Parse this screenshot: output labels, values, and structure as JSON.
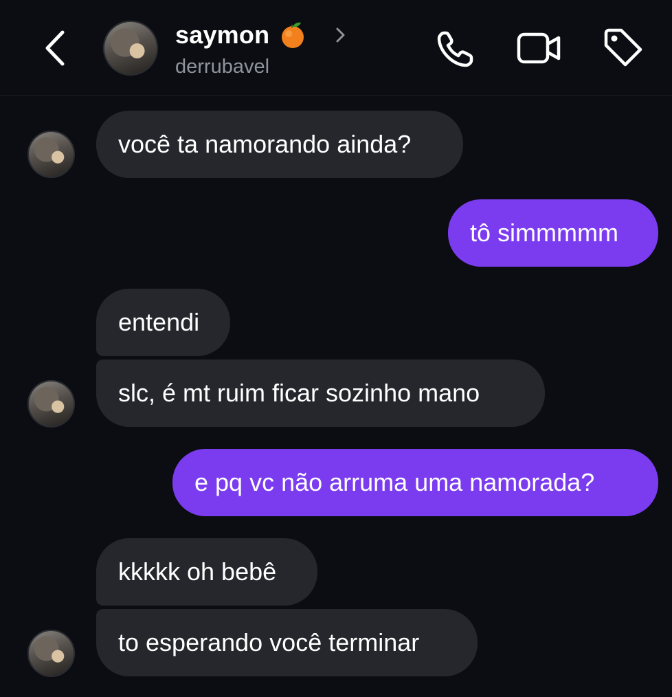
{
  "header": {
    "name": "saymon",
    "username": "derrubavel",
    "name_emoji": "orange-emoji",
    "icons": {
      "back": "chevron-left-icon",
      "profile": "chevron-right-icon",
      "call": "phone-icon",
      "video": "video-camera-icon",
      "tag": "tag-icon"
    }
  },
  "colors": {
    "background": "#0b0d12",
    "incoming_bubble": "#25272d",
    "outgoing_bubble": "#7b3cf0",
    "secondary_text": "#8f949c"
  },
  "messages": [
    {
      "sender": "them",
      "text": "você ta namorando ainda?"
    },
    {
      "sender": "me",
      "text": "tô simmmmm"
    },
    {
      "sender": "them",
      "text": "entendi"
    },
    {
      "sender": "them",
      "text": "slc, é mt ruim ficar sozinho mano"
    },
    {
      "sender": "me",
      "text": "e pq vc não arruma uma namorada?"
    },
    {
      "sender": "them",
      "text": "kkkkk oh bebê"
    },
    {
      "sender": "them",
      "text": "to esperando você terminar"
    }
  ]
}
